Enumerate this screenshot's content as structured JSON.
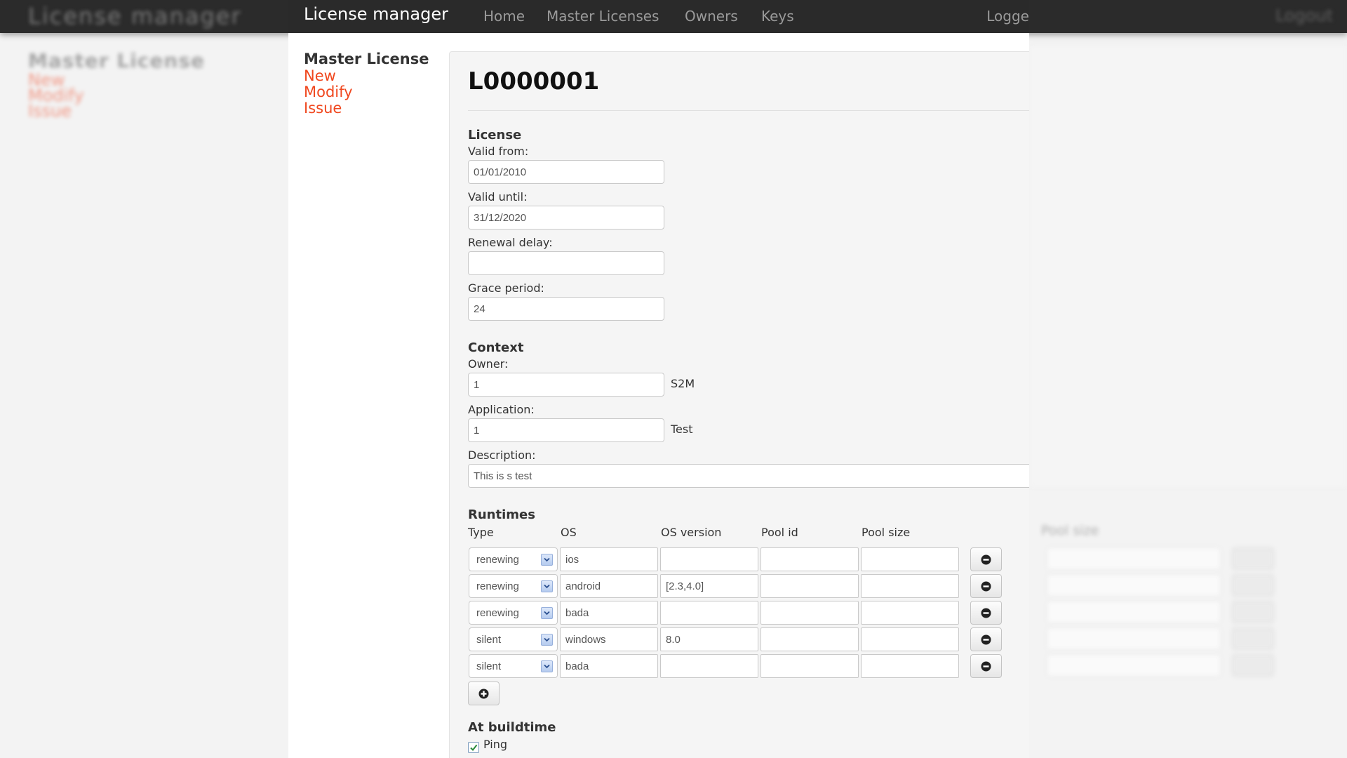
{
  "app": {
    "brand": "License manager",
    "nav": [
      "Home",
      "Master Licenses",
      "Owners",
      "Keys"
    ],
    "logout": "Logge"
  },
  "sidebar": {
    "title": "Master License",
    "links": [
      "New",
      "Modify",
      "Issue"
    ]
  },
  "license_id": "L0000001",
  "license": {
    "heading": "License",
    "valid_from_label": "Valid from:",
    "valid_from": "01/01/2010",
    "valid_until_label": "Valid until:",
    "valid_until": "31/12/2020",
    "renewal_delay_label": "Renewal delay:",
    "renewal_delay": "",
    "grace_period_label": "Grace period:",
    "grace_period": "24"
  },
  "context": {
    "heading": "Context",
    "owner_label": "Owner:",
    "owner": "1",
    "owner_name": "S2M",
    "application_label": "Application:",
    "application": "1",
    "application_name": "Test",
    "description_label": "Description:",
    "description": "This is s test"
  },
  "runtimes": {
    "heading": "Runtimes",
    "columns": [
      "Type",
      "OS",
      "OS version",
      "Pool id",
      "Pool size"
    ],
    "rows": [
      {
        "type": "renewing",
        "os": "ios",
        "os_version": "",
        "pool_id": "",
        "pool_size": ""
      },
      {
        "type": "renewing",
        "os": "android",
        "os_version": "[2.3,4.0]",
        "pool_id": "",
        "pool_size": ""
      },
      {
        "type": "renewing",
        "os": "bada",
        "os_version": "",
        "pool_id": "",
        "pool_size": ""
      },
      {
        "type": "silent",
        "os": "windows",
        "os_version": "8.0",
        "pool_id": "",
        "pool_size": ""
      },
      {
        "type": "silent",
        "os": "bada",
        "os_version": "",
        "pool_id": "",
        "pool_size": ""
      }
    ]
  },
  "buildtime": {
    "heading": "At buildtime",
    "ping_label": "Ping",
    "ping_checked": true
  },
  "background": {
    "brand": "License manager",
    "logout": "Logout",
    "side_title": "Master License",
    "side_links": [
      "New",
      "Modify",
      "Issue"
    ],
    "pool_size_label": "Pool size"
  },
  "icons": {
    "remove": "minus-circle-icon",
    "add": "plus-circle-icon",
    "dropdown": "chevron-down-icon",
    "check": "check-icon"
  },
  "colors": {
    "navbar": "#2a2a2a",
    "link": "#f0471e",
    "panel": "#f5f5f5"
  }
}
